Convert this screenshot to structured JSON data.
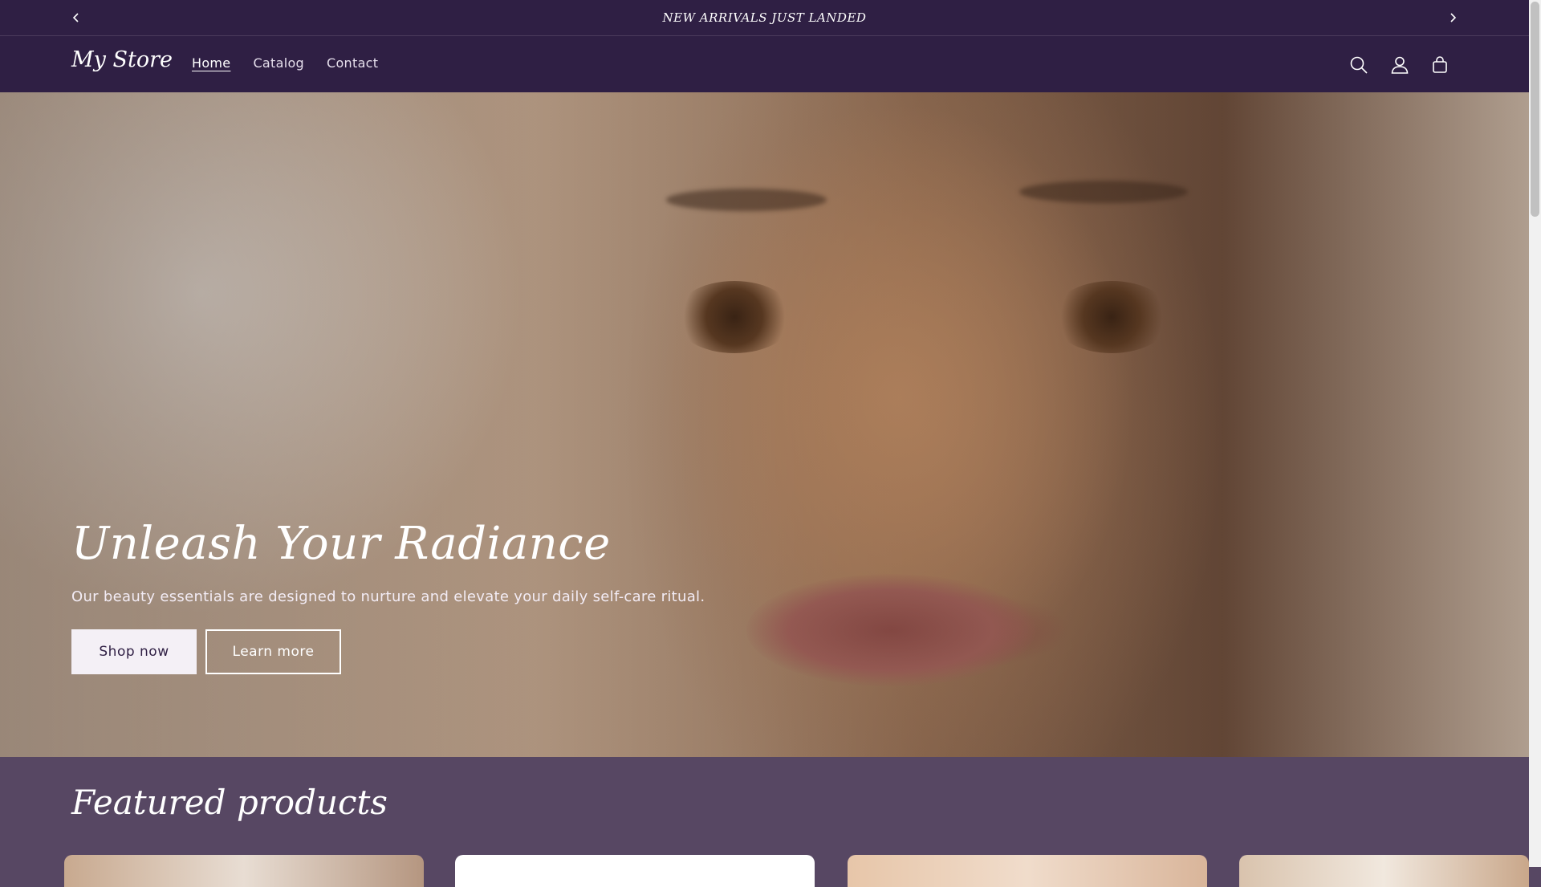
{
  "announcement": {
    "text": "NEW ARRIVALS JUST LANDED",
    "prev_icon": "chevron-left-icon",
    "next_icon": "chevron-right-icon"
  },
  "header": {
    "logo": "My Store",
    "nav": [
      {
        "label": "Home",
        "active": true
      },
      {
        "label": "Catalog",
        "active": false
      },
      {
        "label": "Contact",
        "active": false
      }
    ],
    "icons": [
      "search-icon",
      "account-icon",
      "cart-icon"
    ]
  },
  "hero": {
    "title": "Unleash Your Radiance",
    "subtitle": "Our beauty essentials are designed to nurture and elevate your daily self-care ritual.",
    "primary_button": "Shop now",
    "secondary_button": "Learn more"
  },
  "featured": {
    "title": "Featured products"
  },
  "colors": {
    "header_bg": "#2f1f44",
    "page_bg": "#574763",
    "text": "#ffffff"
  }
}
